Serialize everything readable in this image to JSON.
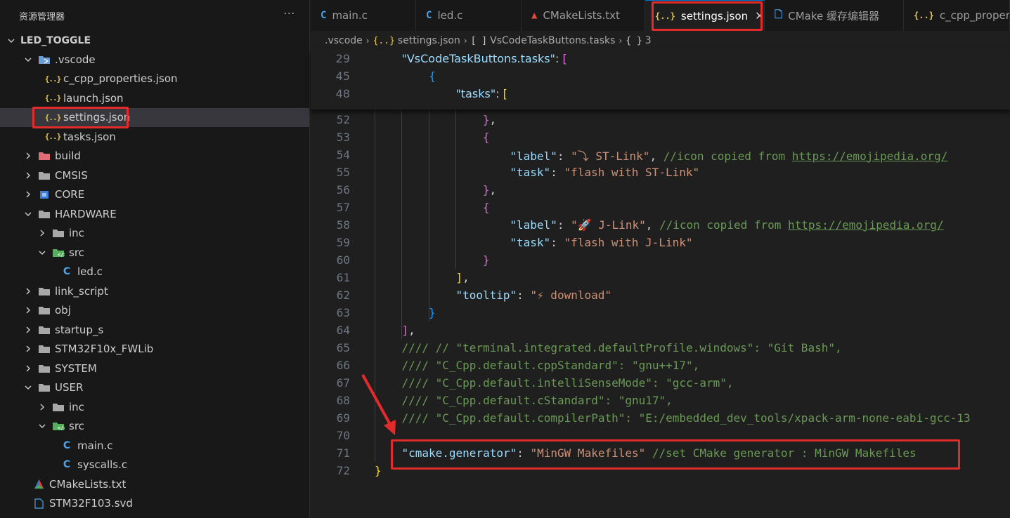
{
  "sidebar": {
    "title": "资源管理器",
    "more": "···",
    "root": "LED_TOGGLE",
    "tree": [
      {
        "label": ".vscode",
        "type": "folder-vscode",
        "open": true,
        "indent": 1
      },
      {
        "label": "c_cpp_properties.json",
        "type": "json",
        "indent": 2
      },
      {
        "label": "launch.json",
        "type": "json",
        "indent": 2
      },
      {
        "label": "settings.json",
        "type": "json",
        "indent": 2,
        "selected": true
      },
      {
        "label": "tasks.json",
        "type": "json",
        "indent": 2
      },
      {
        "label": "build",
        "type": "folder-build",
        "open": false,
        "indent": 1
      },
      {
        "label": "CMSIS",
        "type": "folder",
        "open": false,
        "indent": 1
      },
      {
        "label": "CORE",
        "type": "folder-core",
        "open": false,
        "indent": 1
      },
      {
        "label": "HARDWARE",
        "type": "folder",
        "open": true,
        "indent": 1
      },
      {
        "label": "inc",
        "type": "folder",
        "open": false,
        "indent": 2
      },
      {
        "label": "src",
        "type": "folder-src",
        "open": true,
        "indent": 2
      },
      {
        "label": "led.c",
        "type": "c",
        "indent": 3
      },
      {
        "label": "link_script",
        "type": "folder",
        "open": false,
        "indent": 1
      },
      {
        "label": "obj",
        "type": "folder",
        "open": false,
        "indent": 1
      },
      {
        "label": "startup_s",
        "type": "folder",
        "open": false,
        "indent": 1
      },
      {
        "label": "STM32F10x_FWLib",
        "type": "folder",
        "open": false,
        "indent": 1
      },
      {
        "label": "SYSTEM",
        "type": "folder",
        "open": false,
        "indent": 1
      },
      {
        "label": "USER",
        "type": "folder",
        "open": true,
        "indent": 1
      },
      {
        "label": "inc",
        "type": "folder",
        "open": false,
        "indent": 2
      },
      {
        "label": "src",
        "type": "folder-src",
        "open": true,
        "indent": 2
      },
      {
        "label": "main.c",
        "type": "c",
        "indent": 3
      },
      {
        "label": "syscalls.c",
        "type": "c",
        "indent": 3
      },
      {
        "label": "CMakeLists.txt",
        "type": "cmake",
        "indent": 1
      },
      {
        "label": "STM32F103.svd",
        "type": "file",
        "indent": 1
      }
    ]
  },
  "tabs": [
    {
      "label": "main.c",
      "icon": "C",
      "icon_color": "#4aa3e8",
      "width": 150
    },
    {
      "label": "led.c",
      "icon": "C",
      "icon_color": "#4aa3e8",
      "width": 150
    },
    {
      "label": "CMakeLists.txt",
      "icon": "▲",
      "icon_color": "#e04e39",
      "width": 176
    },
    {
      "label": "settings.json",
      "icon": "{..}",
      "icon_color": "#e7c94a",
      "width": 170,
      "active": true,
      "close": "✕"
    },
    {
      "label": "CMake 缓存编辑器",
      "icon": "🗋",
      "icon_color": "#4aa3e8",
      "width": 198
    },
    {
      "label": "c_cpp_propert",
      "icon": "{..}",
      "icon_color": "#e7c94a",
      "width": 151
    }
  ],
  "breadcrumb": [
    {
      "label": ".vscode",
      "icon": ""
    },
    {
      "label": "settings.json",
      "icon": "{..}"
    },
    {
      "label": "VsCodeTaskButtons.tasks",
      "icon": "[ ]"
    },
    {
      "label": "3",
      "icon": "{ }"
    }
  ],
  "code": {
    "sticky": [
      {
        "n": "29",
        "indent": 1,
        "tokens": [
          [
            "k",
            "\"VsCodeTaskButtons.tasks\""
          ],
          [
            "p",
            ": "
          ],
          [
            "b2",
            "["
          ]
        ]
      },
      {
        "n": "45",
        "indent": 2,
        "tokens": [
          [
            "b3",
            "{"
          ]
        ]
      },
      {
        "n": "48",
        "indent": 3,
        "tokens": [
          [
            "k",
            "\"tasks\""
          ],
          [
            "p",
            ": "
          ],
          [
            "b1",
            "["
          ]
        ]
      }
    ],
    "lines": [
      {
        "n": "52",
        "indent": 4,
        "tokens": [
          [
            "b2",
            "}"
          ],
          [
            "p",
            ","
          ]
        ]
      },
      {
        "n": "53",
        "indent": 4,
        "tokens": [
          [
            "b2",
            "{"
          ]
        ]
      },
      {
        "n": "54",
        "indent": 5,
        "tokens": [
          [
            "k",
            "\"label\""
          ],
          [
            "p",
            ": "
          ],
          [
            "s",
            "\"⤵ ST-Link\""
          ],
          [
            "p",
            ", "
          ],
          [
            "cm",
            "//icon copied from "
          ],
          [
            "url",
            "https://emojipedia.org/"
          ]
        ]
      },
      {
        "n": "55",
        "indent": 5,
        "tokens": [
          [
            "k",
            "\"task\""
          ],
          [
            "p",
            ": "
          ],
          [
            "s",
            "\"flash with ST-Link\""
          ]
        ]
      },
      {
        "n": "56",
        "indent": 4,
        "tokens": [
          [
            "b2",
            "}"
          ],
          [
            "p",
            ","
          ]
        ]
      },
      {
        "n": "57",
        "indent": 4,
        "tokens": [
          [
            "b2",
            "{"
          ]
        ]
      },
      {
        "n": "58",
        "indent": 5,
        "tokens": [
          [
            "k",
            "\"label\""
          ],
          [
            "p",
            ": "
          ],
          [
            "s",
            "\"🚀 J-Link\""
          ],
          [
            "p",
            ", "
          ],
          [
            "cm",
            "//icon copied from "
          ],
          [
            "url",
            "https://emojipedia.org/"
          ]
        ]
      },
      {
        "n": "59",
        "indent": 5,
        "tokens": [
          [
            "k",
            "\"task\""
          ],
          [
            "p",
            ": "
          ],
          [
            "s",
            "\"flash with J-Link\""
          ]
        ]
      },
      {
        "n": "60",
        "indent": 4,
        "tokens": [
          [
            "b2",
            "}"
          ]
        ]
      },
      {
        "n": "61",
        "indent": 3,
        "tokens": [
          [
            "b1",
            "]"
          ],
          [
            "p",
            ","
          ]
        ]
      },
      {
        "n": "62",
        "indent": 3,
        "tokens": [
          [
            "k",
            "\"tooltip\""
          ],
          [
            "p",
            ": "
          ],
          [
            "s",
            "\"⚡ download\""
          ]
        ]
      },
      {
        "n": "63",
        "indent": 2,
        "tokens": [
          [
            "b3",
            "}"
          ]
        ]
      },
      {
        "n": "64",
        "indent": 1,
        "tokens": [
          [
            "b2",
            "]"
          ],
          [
            "p",
            ","
          ]
        ]
      },
      {
        "n": "65",
        "indent": 1,
        "tokens": [
          [
            "cm",
            "//// // \"terminal.integrated.defaultProfile.windows\": \"Git Bash\","
          ]
        ]
      },
      {
        "n": "66",
        "indent": 1,
        "tokens": [
          [
            "cm",
            "//// \"C_Cpp.default.cppStandard\": \"gnu++17\","
          ]
        ]
      },
      {
        "n": "67",
        "indent": 1,
        "tokens": [
          [
            "cm",
            "//// \"C_Cpp.default.intelliSenseMode\": \"gcc-arm\","
          ]
        ]
      },
      {
        "n": "68",
        "indent": 1,
        "tokens": [
          [
            "cm",
            "//// \"C_Cpp.default.cStandard\": \"gnu17\","
          ]
        ]
      },
      {
        "n": "69",
        "indent": 1,
        "tokens": [
          [
            "cm",
            "//// \"C_Cpp.default.compilerPath\": \"E:/embedded_dev_tools/xpack-arm-none-eabi-gcc-13"
          ]
        ]
      },
      {
        "n": "70",
        "indent": 1,
        "tokens": []
      },
      {
        "n": "71",
        "indent": 1,
        "tokens": [
          [
            "k",
            "\"cmake.generator\""
          ],
          [
            "p",
            ": "
          ],
          [
            "s",
            "\"MinGW Makefiles\""
          ],
          [
            "p",
            " "
          ],
          [
            "cm",
            "//set CMake generator : MinGW Makefiles"
          ]
        ]
      },
      {
        "n": "72",
        "indent": 0,
        "tokens": [
          [
            "b1",
            "}"
          ]
        ]
      }
    ]
  },
  "colors": {
    "highlight": "#e32b2b",
    "accent": "#0078d4"
  }
}
